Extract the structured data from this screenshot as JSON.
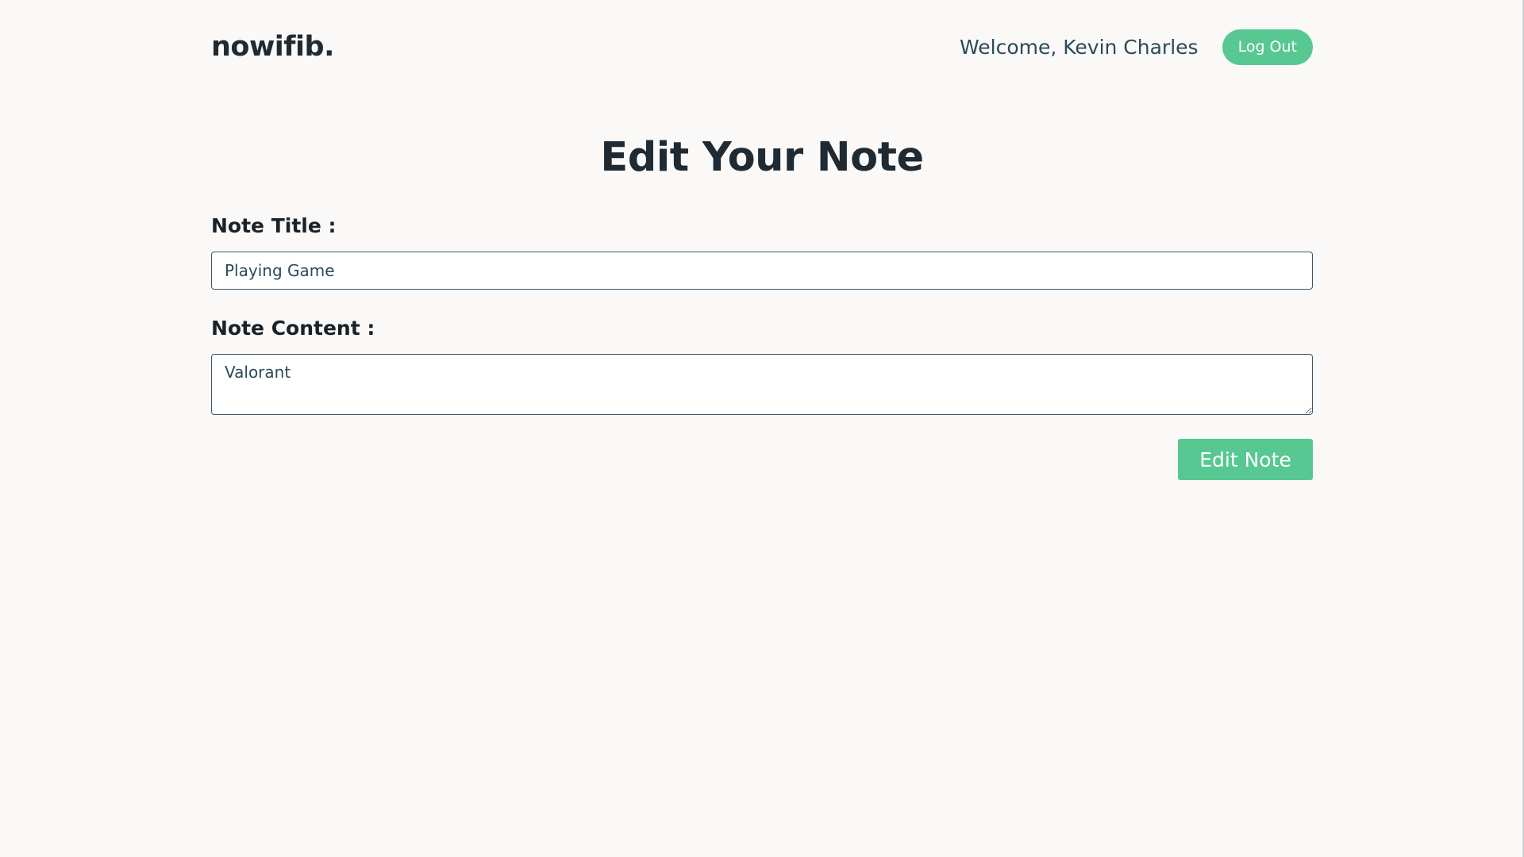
{
  "header": {
    "brand": "nowifib.",
    "welcome_text": "Welcome, Kevin Charles",
    "logout_label": "Log Out"
  },
  "page": {
    "title": "Edit Your Note"
  },
  "form": {
    "title_label": "Note Title :",
    "title_value": "Playing Game",
    "content_label": "Note Content :",
    "content_value": "Valorant",
    "submit_label": "Edit Note"
  },
  "colors": {
    "accent": "#57c892",
    "background": "#faf9f8",
    "text_dark": "#1f2a33",
    "text_muted": "#2b4a5a"
  }
}
